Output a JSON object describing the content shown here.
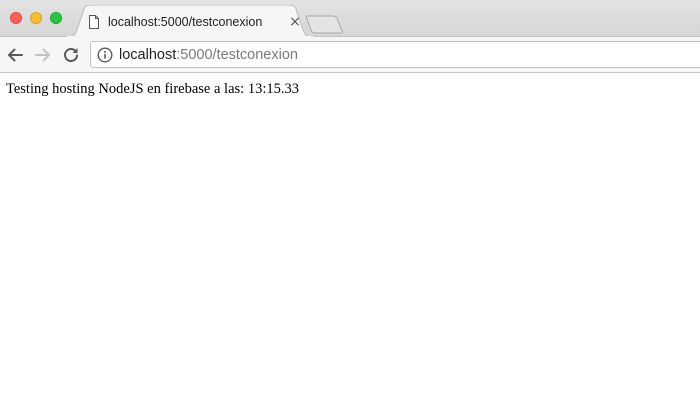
{
  "window": {
    "controls": [
      "close",
      "minimize",
      "maximize"
    ]
  },
  "tab": {
    "title": "localhost:5000/testconexion",
    "close_glyph": "×",
    "icon": "document-icon"
  },
  "toolbar": {
    "back_icon": "back-arrow-icon",
    "forward_icon": "forward-arrow-icon",
    "reload_icon": "reload-icon",
    "forward_enabled": false
  },
  "address_bar": {
    "info_icon": "info-icon",
    "url_host": "localhost",
    "url_rest": ":5000/testconexion"
  },
  "page": {
    "body_text": "Testing hosting NodeJS en firebase a las: 13:15.33"
  },
  "colors": {
    "close": "#fc5f57",
    "minimize": "#fdbc2e",
    "maximize": "#27c840",
    "tabstrip": "#d9d9d9",
    "toolbar": "#f6f6f6"
  }
}
